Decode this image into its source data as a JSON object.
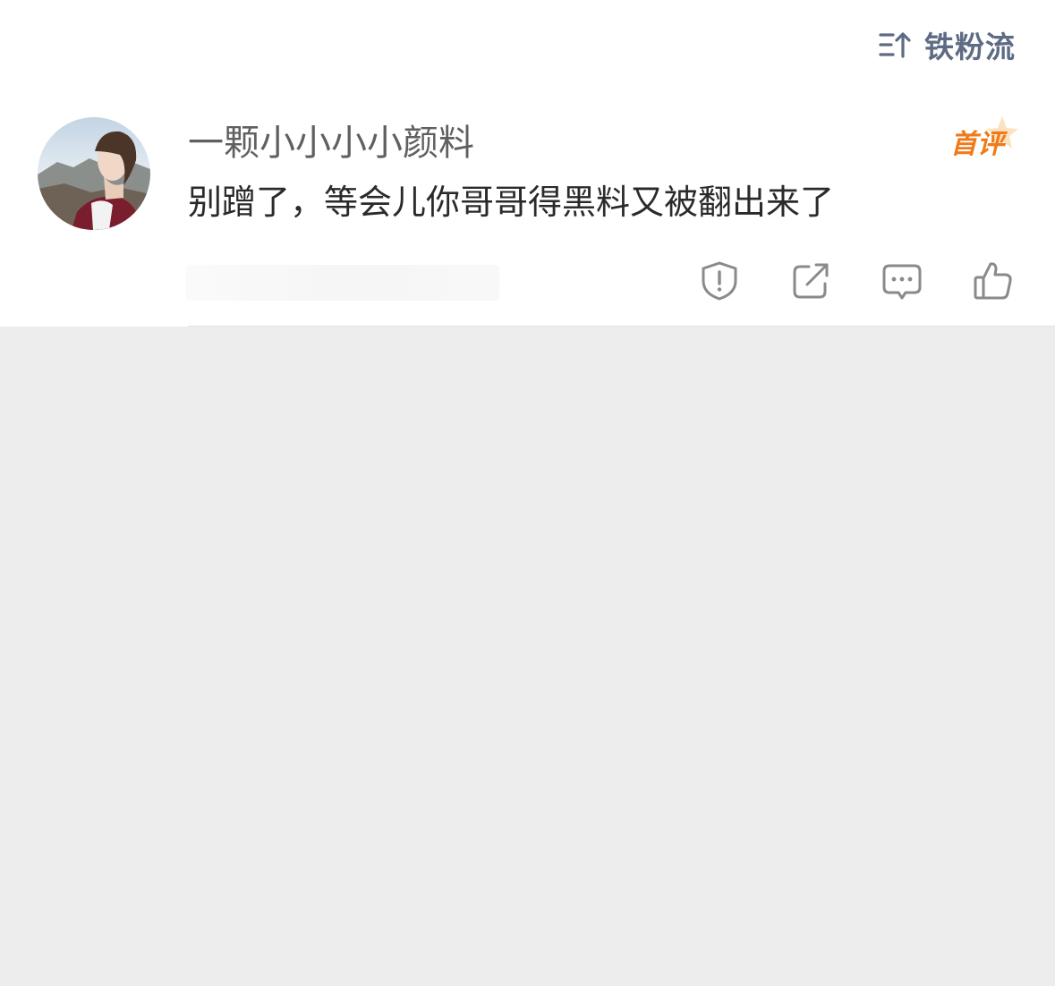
{
  "header": {
    "sort_label": "铁粉流",
    "sort_icon": "sort-up-icon"
  },
  "comment": {
    "username": "一颗小小小小颜料",
    "badge": "首评",
    "text": "别蹭了，等会儿你哥哥得黑料又被翻出来了",
    "actions": [
      "report-icon",
      "share-icon",
      "reply-icon",
      "like-icon"
    ]
  },
  "colors": {
    "badge": "#f07a1a",
    "sort_label": "#5d6b84",
    "background": "#ededed"
  }
}
